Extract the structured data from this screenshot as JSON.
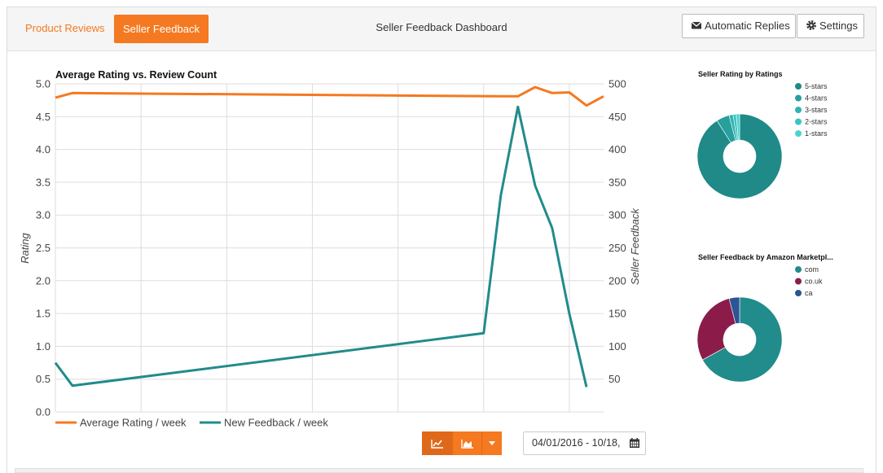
{
  "header": {
    "tab_product_reviews": "Product Reviews",
    "tab_seller_feedback": "Seller Feedback",
    "title": "Seller Feedback Dashboard",
    "btn_auto_replies": "Automatic Replies",
    "btn_settings": "Settings"
  },
  "controls": {
    "date_range": "04/01/2016 - 10/18,",
    "active_view": "line"
  },
  "colors": {
    "accent": "#f47920",
    "teal": "#228b8b",
    "maroon": "#8b1c4a",
    "navy": "#2c5496"
  },
  "chart_data": [
    {
      "type": "line",
      "title": "Average Rating vs. Review Count",
      "ylabel": "Rating",
      "y2label": "Seller Feedback",
      "ylim": [
        0,
        5
      ],
      "y2lim": [
        0,
        500
      ],
      "yticks": [
        "0.0",
        "0.5",
        "1.0",
        "1.5",
        "2.0",
        "2.5",
        "3.0",
        "3.5",
        "4.0",
        "4.5",
        "5.0"
      ],
      "y2ticks": [
        "50",
        "100",
        "150",
        "200",
        "250",
        "300",
        "350",
        "400",
        "450",
        "500"
      ],
      "grid": true,
      "legend": "bottom-left",
      "series": [
        {
          "name": "Average Rating / week",
          "axis": "left",
          "color": "#f47920",
          "x": [
            0,
            1,
            26,
            27,
            28,
            29,
            30,
            31,
            32
          ],
          "values": [
            4.79,
            4.86,
            4.81,
            4.81,
            4.95,
            4.86,
            4.87,
            4.67,
            4.81
          ]
        },
        {
          "name": "New Feedback / week",
          "axis": "right",
          "color": "#228b8b",
          "x": [
            0,
            1,
            25,
            26,
            27,
            28,
            29,
            30,
            31
          ],
          "values": [
            75,
            40,
            120,
            330,
            465,
            345,
            280,
            150,
            38
          ]
        }
      ]
    },
    {
      "type": "pie",
      "title": "Seller Rating by Ratings",
      "legend": "right",
      "labels": [
        "5-stars",
        "4-stars",
        "3-stars",
        "2-stars",
        "1-stars"
      ],
      "values": [
        91,
        5,
        1.5,
        1.2,
        1.3
      ],
      "colors": [
        "#1f8a88",
        "#27a09d",
        "#2fb3b0",
        "#39c4c1",
        "#4ad3d1"
      ]
    },
    {
      "type": "pie",
      "title": "Seller Feedback by Amazon Marketpl...",
      "legend": "right",
      "labels": [
        "com",
        "co.uk",
        "ca"
      ],
      "values": [
        67,
        29,
        4
      ],
      "colors": [
        "#228b8b",
        "#8b1c4a",
        "#2c5496"
      ]
    }
  ]
}
